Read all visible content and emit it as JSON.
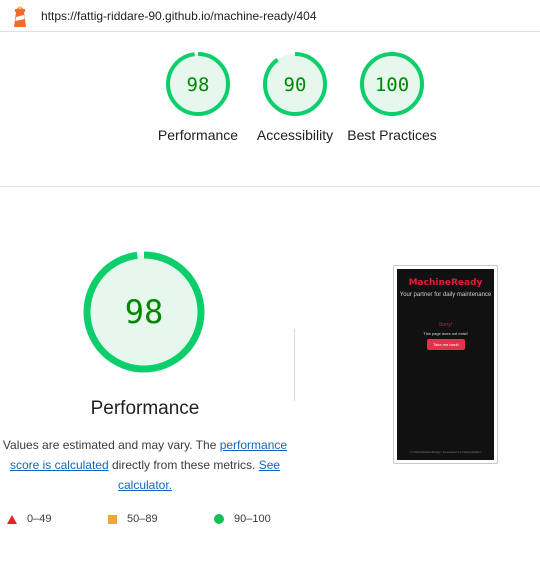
{
  "browser": {
    "url": "https://fattig-riddare-90.github.io/machine-ready/404",
    "icon": "lighthouse-icon"
  },
  "summary": {
    "scores": [
      {
        "score": 98,
        "label": "Performance"
      },
      {
        "score": 90,
        "label": "Accessibility"
      },
      {
        "score": 100,
        "label": "Best Practices"
      }
    ]
  },
  "performance": {
    "score": 98,
    "title": "Performance",
    "text_before": "Values are estimated and may vary. The ",
    "link_calc": "performance score is calculated",
    "text_mid": " directly from these metrics. ",
    "link_calculator": "See calculator."
  },
  "legend": {
    "fail": "0–49",
    "average": "50–89",
    "pass": "90–100"
  },
  "thumbnail": {
    "brand": "MachineReady",
    "tagline": "Your partner for daily maintenance",
    "sorry": "Sorry!",
    "message": "This page does not exist!",
    "button": "Take me back!",
    "footer": "© 2024 MachineReady | Developed by Fattig Riddare"
  },
  "colors": {
    "pass": "#0cce6b",
    "pass_bg": "#e6f8ee",
    "pass_text": "#008800",
    "average": "#f2a53a",
    "fail": "#e02525",
    "link": "#1565c0"
  }
}
